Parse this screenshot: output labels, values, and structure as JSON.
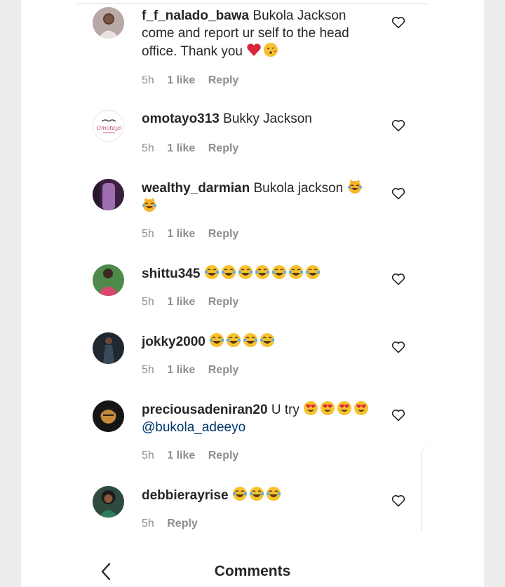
{
  "header": {
    "title": "Comments"
  },
  "comments": [
    {
      "username": "f_f_nalado_bawa",
      "text": "Bukola Jackson come and report ur self to the head office. Thank you",
      "emojis": [
        "heart",
        "kiss"
      ],
      "time": "5h",
      "likes": "1 like",
      "reply": "Reply"
    },
    {
      "username": "omotayo313",
      "text": "Bukky Jackson",
      "time": "5h",
      "likes": "1 like",
      "reply": "Reply",
      "avatar_text": "Omotayo"
    },
    {
      "username": "wealthy_darmian",
      "text": "Bukola jackson",
      "emojis": [
        "cat-joy",
        "cat-joy"
      ],
      "time": "5h",
      "likes": "1 like",
      "reply": "Reply"
    },
    {
      "username": "shittu345",
      "text": "",
      "emojis": [
        "joy",
        "joy",
        "joy",
        "joy",
        "joy",
        "joy",
        "joy"
      ],
      "time": "5h",
      "likes": "1 like",
      "reply": "Reply"
    },
    {
      "username": "jokky2000",
      "text": "",
      "emojis": [
        "joy",
        "joy",
        "joy",
        "joy"
      ],
      "time": "5h",
      "likes": "1 like",
      "reply": "Reply"
    },
    {
      "username": "preciousadeniran20",
      "text": "U try",
      "emojis": [
        "heart-eyes",
        "heart-eyes",
        "heart-eyes",
        "heart-eyes"
      ],
      "mention": "@bukola_adeeyo",
      "time": "5h",
      "likes": "1 like",
      "reply": "Reply"
    },
    {
      "username": "debbierayrise",
      "text": "",
      "emojis": [
        "joy",
        "joy",
        "joy"
      ],
      "time": "5h",
      "reply": "Reply"
    }
  ],
  "icons": {
    "like": "heart-outline-icon",
    "back": "chevron-left-icon"
  },
  "colors": {
    "text": "#262626",
    "meta": "#8e8e8e",
    "mention": "#00376b"
  }
}
